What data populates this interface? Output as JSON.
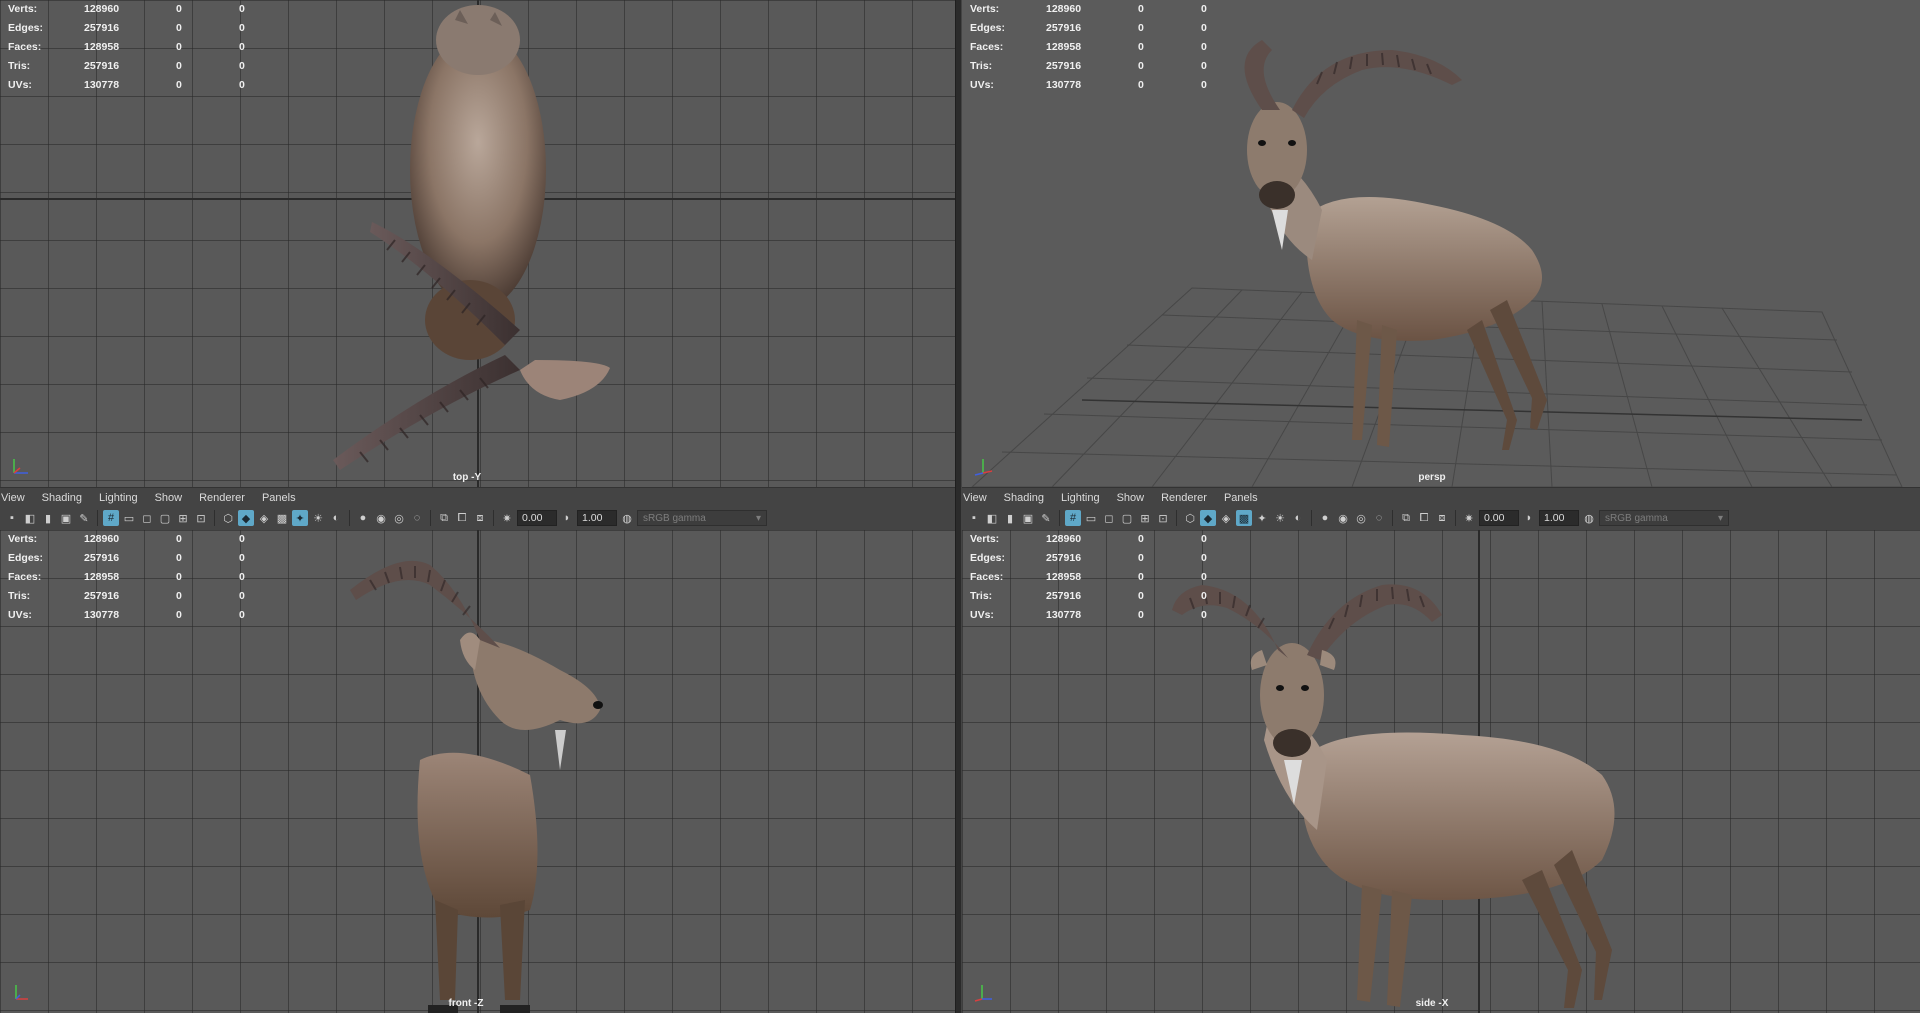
{
  "menus": [
    "View",
    "Shading",
    "Lighting",
    "Show",
    "Renderer",
    "Panels"
  ],
  "toolbar": {
    "exposure_value": "0.00",
    "gamma_value": "1.00",
    "color_space": "sRGB gamma"
  },
  "hud": {
    "rows": [
      {
        "label": "Verts:",
        "v1": "128960",
        "v2": "0",
        "v3": "0"
      },
      {
        "label": "Edges:",
        "v1": "257916",
        "v2": "0",
        "v3": "0"
      },
      {
        "label": "Faces:",
        "v1": "128958",
        "v2": "0",
        "v3": "0"
      },
      {
        "label": "Tris:",
        "v1": "257916",
        "v2": "0",
        "v3": "0"
      },
      {
        "label": "UVs:",
        "v1": "130778",
        "v2": "0",
        "v3": "0"
      }
    ]
  },
  "viewports": {
    "top": {
      "camera": "top -Y"
    },
    "persp": {
      "camera": "persp"
    },
    "front": {
      "camera": "front -Z"
    },
    "side": {
      "camera": "side -X"
    }
  },
  "colors": {
    "viewport_bg": "#595959",
    "accent": "#5fa8c8",
    "axis_x": "#d84040",
    "axis_y": "#48c848",
    "axis_z": "#4060e0"
  }
}
